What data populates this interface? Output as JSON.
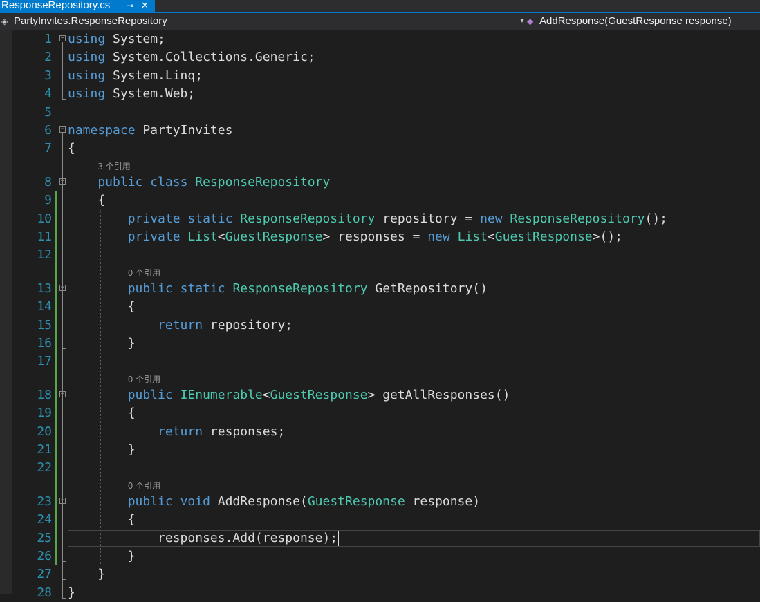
{
  "tab": {
    "title": "ResponseRepository.cs",
    "pin_glyph": "⊸",
    "close_glyph": "✕"
  },
  "nav": {
    "left_icon": "class-icon",
    "left": "PartyInvites.ResponseRepository",
    "right_icon": "method-icon",
    "right": "AddResponse(GuestResponse response)"
  },
  "lenses": [
    {
      "before_line": 8,
      "indent": 4,
      "text": "3 个引用"
    },
    {
      "before_line": 13,
      "indent": 8,
      "text": "0 个引用"
    },
    {
      "before_line": 18,
      "indent": 8,
      "text": "0 个引用"
    },
    {
      "before_line": 23,
      "indent": 8,
      "text": "0 个引用"
    }
  ],
  "lines": [
    {
      "n": 1,
      "indent": 0,
      "fold": "open",
      "tokens": [
        [
          "kw",
          "using"
        ],
        [
          "p",
          " System;"
        ]
      ]
    },
    {
      "n": 2,
      "indent": 0,
      "tokens": [
        [
          "kw",
          "using"
        ],
        [
          "p",
          " System.Collections.Generic;"
        ]
      ]
    },
    {
      "n": 3,
      "indent": 0,
      "tokens": [
        [
          "kw",
          "using"
        ],
        [
          "p",
          " System.Linq;"
        ]
      ]
    },
    {
      "n": 4,
      "indent": 0,
      "tokens": [
        [
          "kw",
          "using"
        ],
        [
          "p",
          " System.Web;"
        ]
      ]
    },
    {
      "n": 5,
      "indent": 0,
      "tokens": []
    },
    {
      "n": 6,
      "indent": 0,
      "fold": "open",
      "tokens": [
        [
          "kw",
          "namespace"
        ],
        [
          "p",
          " PartyInvites"
        ]
      ]
    },
    {
      "n": 7,
      "indent": 0,
      "tokens": [
        [
          "p",
          "{"
        ]
      ]
    },
    {
      "n": 8,
      "indent": 4,
      "fold": "open",
      "tokens": [
        [
          "kw",
          "public"
        ],
        [
          "p",
          " "
        ],
        [
          "kw",
          "class"
        ],
        [
          "p",
          " "
        ],
        [
          "ty",
          "ResponseRepository"
        ]
      ]
    },
    {
      "n": 9,
      "indent": 4,
      "tokens": [
        [
          "p",
          "{"
        ]
      ]
    },
    {
      "n": 10,
      "indent": 8,
      "tokens": [
        [
          "kw",
          "private"
        ],
        [
          "p",
          " "
        ],
        [
          "kw",
          "static"
        ],
        [
          "p",
          " "
        ],
        [
          "ty",
          "ResponseRepository"
        ],
        [
          "p",
          " repository = "
        ],
        [
          "kw",
          "new"
        ],
        [
          "p",
          " "
        ],
        [
          "ty",
          "ResponseRepository"
        ],
        [
          "p",
          "();"
        ]
      ]
    },
    {
      "n": 11,
      "indent": 8,
      "tokens": [
        [
          "kw",
          "private"
        ],
        [
          "p",
          " "
        ],
        [
          "ty",
          "List"
        ],
        [
          "p",
          "<"
        ],
        [
          "ty",
          "GuestResponse"
        ],
        [
          "p",
          "> responses = "
        ],
        [
          "kw",
          "new"
        ],
        [
          "p",
          " "
        ],
        [
          "ty",
          "List"
        ],
        [
          "p",
          "<"
        ],
        [
          "ty",
          "GuestResponse"
        ],
        [
          "p",
          ">();"
        ]
      ]
    },
    {
      "n": 12,
      "indent": 0,
      "tokens": []
    },
    {
      "n": 13,
      "indent": 8,
      "fold": "open",
      "tokens": [
        [
          "kw",
          "public"
        ],
        [
          "p",
          " "
        ],
        [
          "kw",
          "static"
        ],
        [
          "p",
          " "
        ],
        [
          "ty",
          "ResponseRepository"
        ],
        [
          "p",
          " GetRepository()"
        ]
      ]
    },
    {
      "n": 14,
      "indent": 8,
      "tokens": [
        [
          "p",
          "{"
        ]
      ]
    },
    {
      "n": 15,
      "indent": 12,
      "tokens": [
        [
          "kw",
          "return"
        ],
        [
          "p",
          " repository;"
        ]
      ]
    },
    {
      "n": 16,
      "indent": 8,
      "tokens": [
        [
          "p",
          "}"
        ]
      ]
    },
    {
      "n": 17,
      "indent": 0,
      "tokens": []
    },
    {
      "n": 18,
      "indent": 8,
      "fold": "open",
      "tokens": [
        [
          "kw",
          "public"
        ],
        [
          "p",
          " "
        ],
        [
          "ty",
          "IEnumerable"
        ],
        [
          "p",
          "<"
        ],
        [
          "ty",
          "GuestResponse"
        ],
        [
          "p",
          "> getAllResponses()"
        ]
      ]
    },
    {
      "n": 19,
      "indent": 8,
      "tokens": [
        [
          "p",
          "{"
        ]
      ]
    },
    {
      "n": 20,
      "indent": 12,
      "tokens": [
        [
          "kw",
          "return"
        ],
        [
          "p",
          " responses;"
        ]
      ]
    },
    {
      "n": 21,
      "indent": 8,
      "tokens": [
        [
          "p",
          "}"
        ]
      ]
    },
    {
      "n": 22,
      "indent": 0,
      "tokens": []
    },
    {
      "n": 23,
      "indent": 8,
      "fold": "open",
      "tokens": [
        [
          "kw",
          "public"
        ],
        [
          "p",
          " "
        ],
        [
          "kw",
          "void"
        ],
        [
          "p",
          " AddResponse("
        ],
        [
          "ty",
          "GuestResponse"
        ],
        [
          "p",
          " response)"
        ]
      ]
    },
    {
      "n": 24,
      "indent": 8,
      "tokens": [
        [
          "p",
          "{"
        ]
      ]
    },
    {
      "n": 25,
      "indent": 12,
      "current": true,
      "tokens": [
        [
          "p",
          "responses.Add(response);"
        ]
      ]
    },
    {
      "n": 26,
      "indent": 8,
      "tokens": [
        [
          "p",
          "}"
        ]
      ]
    },
    {
      "n": 27,
      "indent": 4,
      "tokens": [
        [
          "p",
          "}"
        ]
      ]
    },
    {
      "n": 28,
      "indent": 0,
      "tokens": [
        [
          "p",
          "}"
        ]
      ]
    }
  ],
  "colors": {
    "keyword": "#569cd6",
    "type": "#4ec9b0",
    "text": "#dcdcdc",
    "line_number": "#2b91af",
    "change_bar": "#57a64a",
    "tab_active": "#007acc"
  }
}
